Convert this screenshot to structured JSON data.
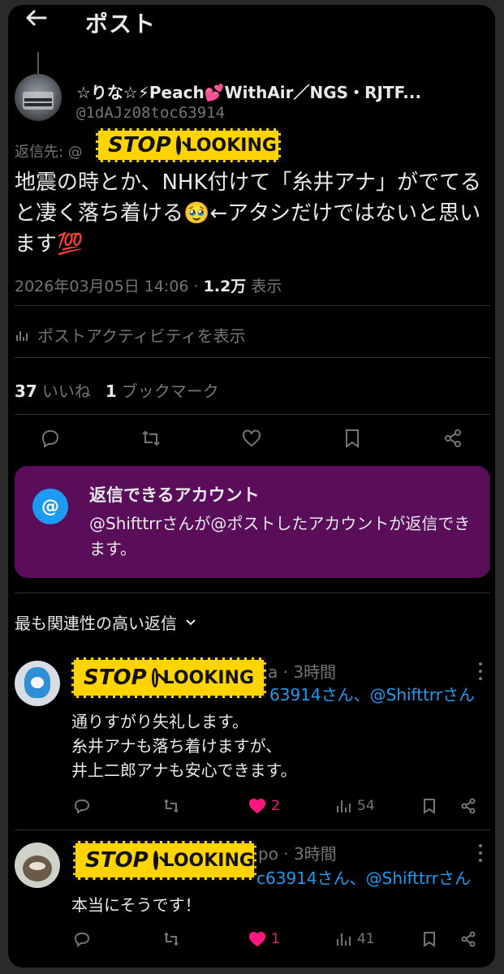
{
  "header": {
    "title": "ポスト"
  },
  "post": {
    "display_name": "☆りな☆⚡Peach💕WithAir／NGS・RJTF...",
    "handle": "@1dAJz08toc63914",
    "reply_to_label": "返信先: @",
    "text": "地震の時とか、NHK付けて「糸井アナ」がでてると凄く落ち着ける🥹←アタシだけではないと思います💯",
    "timestamp": "2026年03月05日 14:06 · ",
    "views_count": "1.2万",
    "views_label": " 表示",
    "activity_label": "ポストアクティビティを表示",
    "likes_count": "37",
    "likes_label": "いいね",
    "bookmarks_count": "1",
    "bookmarks_label": "ブックマーク"
  },
  "stop_banner": {
    "stop": "STOP",
    "looking": "LOOKING"
  },
  "reply_card": {
    "title": "返信できるアカウント",
    "body": "@Shifttrrさんが@ポストしたアカウントが返信できます。"
  },
  "sort_label": "最も関連性の高い返信",
  "replies": [
    {
      "name_fragment": "a",
      "time": " · 3時間",
      "reply_to": "63914さん、@Shifttrrさん",
      "text_line1": "通りすがり失礼します。",
      "text_line2": "糸井アナも落ち着けますが、",
      "text_line3": "井上二郎アナも安心できます。",
      "likes": "2",
      "views": "54"
    },
    {
      "name_fragment": "po",
      "time": " · 3時間",
      "reply_to": "c63914さん、@Shifttrrさん",
      "text_line1": "本当にそうです！",
      "likes": "1",
      "views": "41"
    }
  ],
  "colors": {
    "background": "#000000",
    "text": "#e7e9ea",
    "muted": "#71767b",
    "link": "#1d9bf0",
    "card_bg": "#5a0e5a",
    "like": "#f91880",
    "stop_yellow": "#ffd400"
  }
}
